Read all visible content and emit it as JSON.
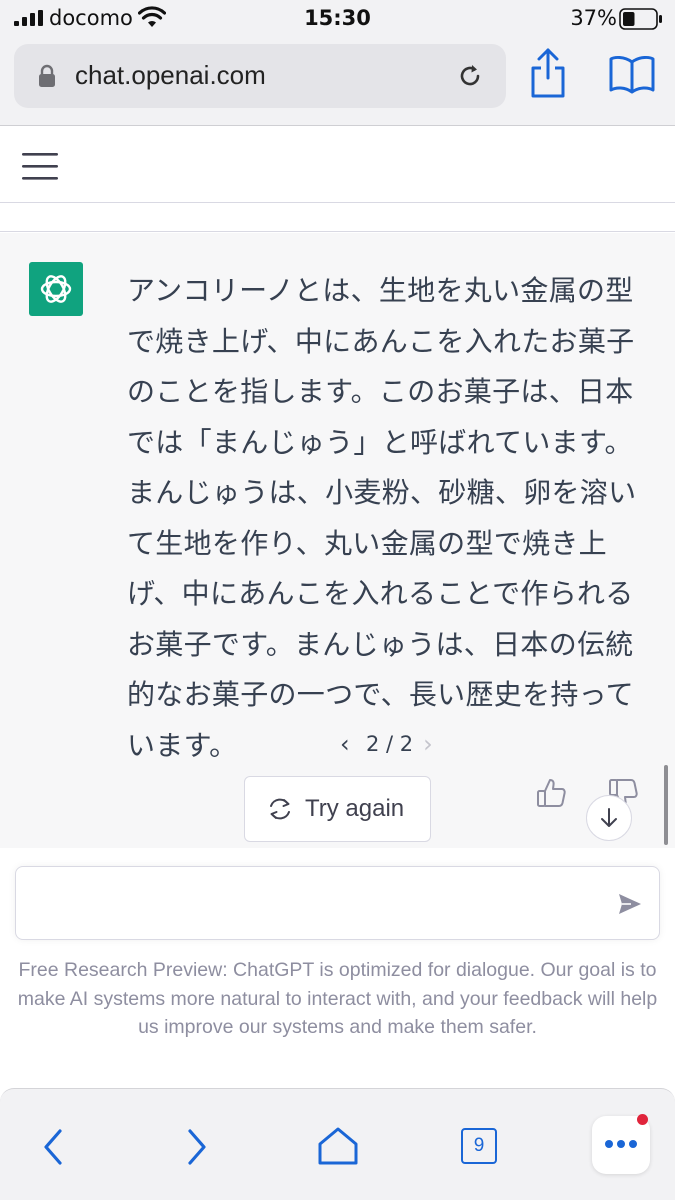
{
  "status_bar": {
    "carrier": "docomo",
    "time": "15:30",
    "battery_percent": "37%",
    "battery_level": 0.37
  },
  "browser": {
    "url": "chat.openai.com"
  },
  "message": {
    "text": "アンコリーノとは、生地を丸い金属の型で焼き上げ、中にあんこを入れたお菓子のことを指します。このお菓子は、日本では「まんじゅう」と呼ばれています。まんじゅうは、小麦粉、砂糖、卵を溶いて生地を作り、丸い金属の型で焼き上げ、中にあんこを入れることで作られるお菓子です。まんじゅうは、日本の伝統的なお菓子の一つで、長い歴史を持っています。",
    "pager": {
      "prev": "‹",
      "label": "2 / 2",
      "next": "›"
    }
  },
  "actions": {
    "try_again": "Try again"
  },
  "composer": {
    "value": "",
    "placeholder": ""
  },
  "disclaimer": "Free Research Preview: ChatGPT is optimized for dialogue. Our goal is to make AI systems more natural to interact with, and your feedback will help us improve our systems and make them safer.",
  "toolbar": {
    "tab_count": "9"
  },
  "colors": {
    "accent_green": "#10a37f",
    "ios_blue": "#1a66d6",
    "notification_red": "#e0243b"
  }
}
